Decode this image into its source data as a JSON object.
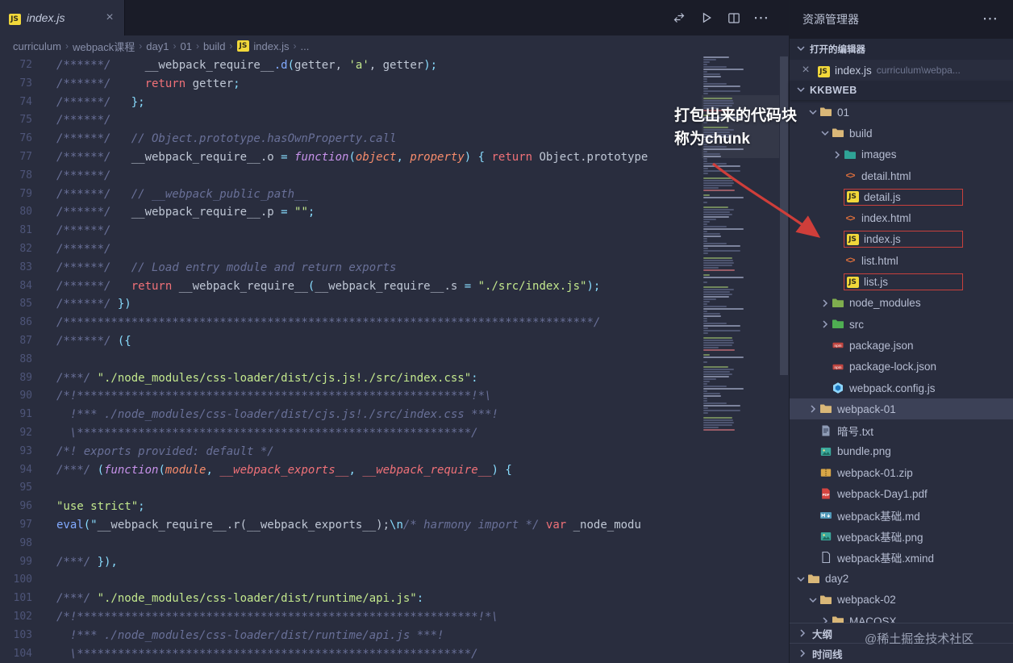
{
  "tab_bar": {
    "tabs": [
      {
        "label": "index.js",
        "icon": "js",
        "preview": true
      }
    ],
    "actions": [
      {
        "name": "open-changes"
      },
      {
        "name": "run"
      },
      {
        "name": "split-editor"
      },
      {
        "name": "more"
      }
    ]
  },
  "breadcrumbs": {
    "items": [
      {
        "label": "curriculum"
      },
      {
        "label": "webpack课程"
      },
      {
        "label": "day1"
      },
      {
        "label": "01"
      },
      {
        "label": "build"
      },
      {
        "label": "index.js",
        "icon": "js"
      },
      {
        "label": "..."
      }
    ]
  },
  "editor": {
    "lines": [
      {
        "n": 72,
        "s": [
          [
            "cm",
            "/******/ "
          ],
          [
            "tx",
            "    __webpack_require__"
          ],
          [
            "fn",
            ".d"
          ],
          [
            "pt",
            "("
          ],
          [
            "tx",
            "getter, "
          ],
          [
            "str",
            "'a'"
          ],
          [
            "tx",
            ", getter"
          ],
          [
            "pt",
            ");"
          ]
        ]
      },
      {
        "n": 73,
        "s": [
          [
            "cm",
            "/******/ "
          ],
          [
            "tx",
            "    "
          ],
          [
            "ret",
            "return"
          ],
          [
            "tx",
            " getter"
          ],
          [
            "pt",
            ";"
          ]
        ]
      },
      {
        "n": 74,
        "s": [
          [
            "cm",
            "/******/ "
          ],
          [
            "tx",
            "  "
          ],
          [
            "pt",
            "};"
          ]
        ]
      },
      {
        "n": 75,
        "s": [
          [
            "cm",
            "/******/"
          ]
        ]
      },
      {
        "n": 76,
        "s": [
          [
            "cm",
            "/******/ "
          ],
          [
            "cm",
            "  // Object.prototype.hasOwnProperty.call"
          ]
        ]
      },
      {
        "n": 77,
        "s": [
          [
            "cm",
            "/******/ "
          ],
          [
            "tx",
            "  __webpack_require__.o "
          ],
          [
            "pt",
            "= "
          ],
          [
            "kw",
            "function"
          ],
          [
            "pt",
            "("
          ],
          [
            "pm",
            "object"
          ],
          [
            "pt",
            ", "
          ],
          [
            "pm",
            "property"
          ],
          [
            "pt",
            ") { "
          ],
          [
            "ret",
            "return"
          ],
          [
            "tx",
            " Object.prototype"
          ]
        ]
      },
      {
        "n": 78,
        "s": [
          [
            "cm",
            "/******/"
          ]
        ]
      },
      {
        "n": 79,
        "s": [
          [
            "cm",
            "/******/ "
          ],
          [
            "cm",
            "  // __webpack_public_path__"
          ]
        ]
      },
      {
        "n": 80,
        "s": [
          [
            "cm",
            "/******/ "
          ],
          [
            "tx",
            "  __webpack_require__.p "
          ],
          [
            "pt",
            "= "
          ],
          [
            "str",
            "\"\""
          ],
          [
            "pt",
            ";"
          ]
        ]
      },
      {
        "n": 81,
        "s": [
          [
            "cm",
            "/******/"
          ]
        ]
      },
      {
        "n": 82,
        "s": [
          [
            "cm",
            "/******/"
          ]
        ]
      },
      {
        "n": 83,
        "s": [
          [
            "cm",
            "/******/ "
          ],
          [
            "cm",
            "  // Load entry module and return exports"
          ]
        ]
      },
      {
        "n": 84,
        "s": [
          [
            "cm",
            "/******/ "
          ],
          [
            "tx",
            "  "
          ],
          [
            "ret",
            "return"
          ],
          [
            "tx",
            " __webpack_require__"
          ],
          [
            "pt",
            "("
          ],
          [
            "tx",
            "__webpack_require__.s "
          ],
          [
            "pt",
            "= "
          ],
          [
            "str",
            "\"./src/index.js\""
          ],
          [
            "pt",
            ");"
          ]
        ]
      },
      {
        "n": 85,
        "s": [
          [
            "cm",
            "/******/ "
          ],
          [
            "pt",
            "})"
          ]
        ]
      },
      {
        "n": 86,
        "s": [
          [
            "cm",
            "/******************************************************************************/"
          ]
        ]
      },
      {
        "n": 87,
        "s": [
          [
            "cm",
            "/******/ "
          ],
          [
            "pt",
            "({"
          ]
        ]
      },
      {
        "n": 88,
        "s": []
      },
      {
        "n": 89,
        "s": [
          [
            "cm",
            "/***/ "
          ],
          [
            "str",
            "\"./node_modules/css-loader/dist/cjs.js!./src/index.css\""
          ],
          [
            "pt",
            ":"
          ]
        ]
      },
      {
        "n": 90,
        "s": [
          [
            "cm",
            "/*!**********************************************************!*\\"
          ]
        ]
      },
      {
        "n": 91,
        "s": [
          [
            "cm",
            "  !*** ./node_modules/css-loader/dist/cjs.js!./src/index.css ***!"
          ]
        ]
      },
      {
        "n": 92,
        "s": [
          [
            "cm",
            "  \\**********************************************************/"
          ]
        ]
      },
      {
        "n": 93,
        "s": [
          [
            "cm",
            "/*! exports provided: default */"
          ]
        ]
      },
      {
        "n": 94,
        "s": [
          [
            "cm",
            "/***/ "
          ],
          [
            "pt",
            "("
          ],
          [
            "kw",
            "function"
          ],
          [
            "pt",
            "("
          ],
          [
            "pm",
            "module"
          ],
          [
            "pt",
            ", "
          ],
          [
            "pmr",
            "__webpack_exports__"
          ],
          [
            "pt",
            ", "
          ],
          [
            "pmr",
            "__webpack_require__"
          ],
          [
            "pt",
            ") {"
          ]
        ]
      },
      {
        "n": 95,
        "s": []
      },
      {
        "n": 96,
        "s": [
          [
            "str",
            "\"use strict\""
          ],
          [
            "pt",
            ";"
          ]
        ]
      },
      {
        "n": 97,
        "s": [
          [
            "fn",
            "eval"
          ],
          [
            "pt",
            "(\""
          ],
          [
            "tx",
            "__webpack_require__.r(__webpack_exports__);"
          ],
          [
            "pt",
            "\\n"
          ],
          [
            "cm",
            "/* harmony import */"
          ],
          [
            "tx",
            " "
          ],
          [
            "ret",
            "var"
          ],
          [
            "tx",
            " _node_modu"
          ]
        ]
      },
      {
        "n": 98,
        "s": []
      },
      {
        "n": 99,
        "s": [
          [
            "cm",
            "/***/ "
          ],
          [
            "pt",
            "}),"
          ]
        ]
      },
      {
        "n": 100,
        "s": []
      },
      {
        "n": 101,
        "s": [
          [
            "cm",
            "/***/ "
          ],
          [
            "str",
            "\"./node_modules/css-loader/dist/runtime/api.js\""
          ],
          [
            "pt",
            ":"
          ]
        ]
      },
      {
        "n": 102,
        "s": [
          [
            "cm",
            "/*!***********************************************************!*\\"
          ]
        ]
      },
      {
        "n": 103,
        "s": [
          [
            "cm",
            "  !*** ./node_modules/css-loader/dist/runtime/api.js ***!"
          ]
        ]
      },
      {
        "n": 104,
        "s": [
          [
            "cm",
            "  \\**********************************************************/"
          ]
        ]
      }
    ]
  },
  "annotation": {
    "line1": "打包出来的代码块",
    "line2": "称为chunk",
    "text_color": "#ffffff",
    "arrow_color": "#cf3e3a"
  },
  "sidebar": {
    "title": "资源管理器",
    "open_editors_header": "打开的编辑器",
    "open_editor_item": {
      "label": "index.js",
      "path": "curriculum\\webpa...",
      "icon": "js"
    },
    "workspace_header": "KKBWEB",
    "tree": [
      {
        "label": "01",
        "level": 1,
        "icon": "folder-yellow",
        "chev": "d"
      },
      {
        "label": "build",
        "level": 2,
        "icon": "folder-yellow",
        "chev": "d"
      },
      {
        "label": "images",
        "level": 3,
        "icon": "folder-teal",
        "chev": "r"
      },
      {
        "label": "detail.html",
        "level": 3,
        "icon": "html"
      },
      {
        "label": "detail.js",
        "level": 3,
        "icon": "js",
        "box": true
      },
      {
        "label": "index.html",
        "level": 3,
        "icon": "html"
      },
      {
        "label": "index.js",
        "level": 3,
        "icon": "js",
        "box": true
      },
      {
        "label": "list.html",
        "level": 3,
        "icon": "html"
      },
      {
        "label": "list.js",
        "level": 3,
        "icon": "js",
        "box": true
      },
      {
        "label": "node_modules",
        "level": 2,
        "icon": "folder-green",
        "chev": "r"
      },
      {
        "label": "src",
        "level": 2,
        "icon": "folder-src",
        "chev": "r"
      },
      {
        "label": "package.json",
        "level": 2,
        "icon": "npm"
      },
      {
        "label": "package-lock.json",
        "level": 2,
        "icon": "npm"
      },
      {
        "label": "webpack.config.js",
        "level": 2,
        "icon": "webpack"
      },
      {
        "label": "webpack-01",
        "level": 1,
        "icon": "folder-yellow",
        "chev": "r",
        "sel": true
      },
      {
        "label": "暗号.txt",
        "level": 1,
        "icon": "txt"
      },
      {
        "label": "bundle.png",
        "level": 1,
        "icon": "image"
      },
      {
        "label": "webpack-01.zip",
        "level": 1,
        "icon": "zip"
      },
      {
        "label": "webpack-Day1.pdf",
        "level": 1,
        "icon": "pdf"
      },
      {
        "label": "webpack基础.md",
        "level": 1,
        "icon": "md"
      },
      {
        "label": "webpack基础.png",
        "level": 1,
        "icon": "image"
      },
      {
        "label": "webpack基础.xmind",
        "level": 1,
        "icon": "xmind"
      },
      {
        "label": "day2",
        "level": 0,
        "icon": "folder-yellow",
        "chev": "d"
      },
      {
        "label": "webpack-02",
        "level": 1,
        "icon": "folder-yellow",
        "chev": "d"
      },
      {
        "label": "MACOSX",
        "level": 2,
        "icon": "folder-yellow",
        "chev": "r"
      }
    ],
    "bottom_sections": [
      {
        "label": "大纲"
      },
      {
        "label": "时间线"
      }
    ]
  },
  "watermark": "@稀土掘金技术社区",
  "colors": {
    "highlight_red": "#c8403c",
    "selection_bg": "#3c4157",
    "js_yellow": "#f1d83a",
    "editor_bg": "#292d3e"
  }
}
